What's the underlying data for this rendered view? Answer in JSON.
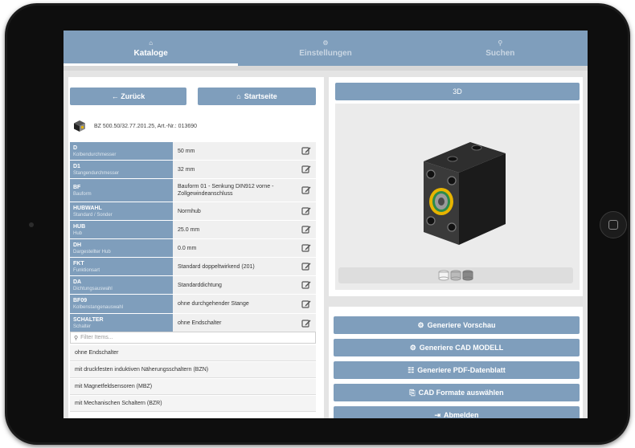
{
  "nav": {
    "tabs": [
      {
        "label": "Kataloge",
        "icon": "home-icon",
        "glyph": "⌂"
      },
      {
        "label": "Einstellungen",
        "icon": "gear-icon",
        "glyph": "⚙"
      },
      {
        "label": "Suchen",
        "icon": "search-icon",
        "glyph": "⚲"
      }
    ]
  },
  "left": {
    "back_label": "← Zurück",
    "home_label": "Startseite",
    "product_title": "BZ 500.50/32.77.201.25, Art.-Nr.: 013690",
    "params": [
      {
        "code": "D",
        "name": "Kolbendurchmesser",
        "value": "50 mm"
      },
      {
        "code": "D1",
        "name": "Stangendurchmesser",
        "value": "32 mm"
      },
      {
        "code": "BF",
        "name": "Bauform",
        "value": "Bauform 01 - Senkung DIN912 vorne - Zollgewindeanschluss"
      },
      {
        "code": "HUBWAHL",
        "name": "Standard / Sonder",
        "value": "Normhub"
      },
      {
        "code": "HUB",
        "name": "Hub",
        "value": "25.0 mm"
      },
      {
        "code": "DH",
        "name": "Dargestellter Hub",
        "value": "0.0 mm"
      },
      {
        "code": "FKT",
        "name": "Funktionsart",
        "value": "Standard doppeltwirkend (201)"
      },
      {
        "code": "DA",
        "name": "Dichtungsauswahl",
        "value": "Standarddichtung"
      },
      {
        "code": "BF09",
        "name": "Kolbenstangenauswahl",
        "value": "ohne durchgehender Stange"
      },
      {
        "code": "SCHALTER",
        "name": "Schalter",
        "value": "ohne Endschalter"
      }
    ],
    "filter_placeholder": "Filter Items...",
    "options": [
      "ohne Endschalter",
      "mit druckfesten induktiven Näherungsschaltern (BZN)",
      "mit Magnetfeldsensoren (MBZ)",
      "mit Mechanischen Schaltern (BZR)"
    ]
  },
  "right": {
    "view_label": "3D",
    "actions": [
      {
        "label": "Generiere Vorschau",
        "icon": "cog-icon",
        "glyph": "⚙"
      },
      {
        "label": "Generiere CAD MODELL",
        "icon": "cogs-icon",
        "glyph": "⚙"
      },
      {
        "label": "Generiere PDF-Datenblatt",
        "icon": "sitemap-icon",
        "glyph": "☷"
      },
      {
        "label": "CAD Formate auswählen",
        "icon": "file-icon",
        "glyph": "⎘"
      },
      {
        "label": "Abmelden",
        "icon": "logout-icon",
        "glyph": "⇥"
      }
    ]
  },
  "colors": {
    "accent": "#7f9ebc",
    "cube": "#1e1e1e",
    "ring": "#e7b400",
    "seal": "#2d8a4a"
  }
}
